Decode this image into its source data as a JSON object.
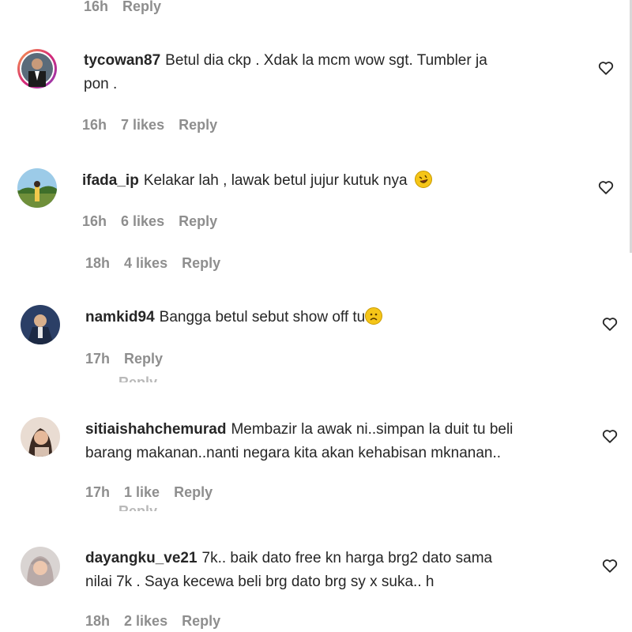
{
  "top": {
    "time": "16h",
    "reply": "Reply"
  },
  "comments": [
    {
      "username": "tycowan87",
      "line1": "Betul dia ckp . Xdak la mcm wow sgt. Tumbler ja",
      "line2": "pon .",
      "time": "16h",
      "likes": "7 likes",
      "reply": "Reply",
      "heart_icon": "heart-outline-icon"
    },
    {
      "username": "ifada_ip",
      "line1": "Kelakar lah , lawak betul jujur kutuk nya",
      "emoji": "rolling-laughing-emoji",
      "time": "16h",
      "likes": "6 likes",
      "reply": "Reply",
      "heart_icon": "heart-outline-icon"
    },
    {
      "time": "18h",
      "likes": "4 likes",
      "reply": "Reply"
    },
    {
      "username": "namkid94",
      "line1": "Bangga betul sebut show off tu",
      "emoji": "disappointed-face-emoji",
      "time": "17h",
      "reply": "Reply",
      "heart_icon": "heart-outline-icon"
    },
    {
      "username": "sitiaishahchemurad",
      "line1": "Membazir la awak ni..simpan la duit tu beli",
      "line2": "barang makanan..nanti negara kita akan kehabisan mknanan..",
      "time": "17h",
      "likes": "1 like",
      "reply": "Reply",
      "heart_icon": "heart-outline-icon"
    },
    {
      "username": "dayangku_ve21",
      "line1": "7k.. baik dato free kn harga brg2 dato sama",
      "line2": "nilai 7k . Saya kecewa beli brg dato brg sy x suka.. h",
      "time": "18h",
      "likes": "2 likes",
      "reply": "Reply",
      "heart_icon": "heart-outline-icon"
    }
  ],
  "ghost_fragments": [
    "Reply",
    "Reply"
  ],
  "colors": {
    "text": "#262626",
    "meta": "#8e8e8e",
    "background": "#ffffff"
  }
}
